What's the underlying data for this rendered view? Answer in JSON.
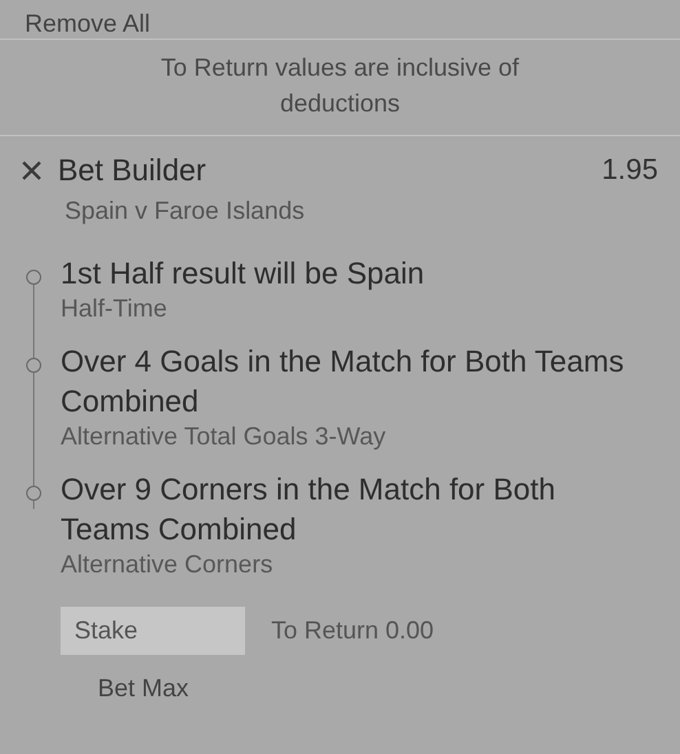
{
  "remove_all": "Remove All",
  "notice": "To Return values are inclusive of deductions",
  "bet": {
    "title": "Bet Builder",
    "odds": "1.95",
    "match": "Spain v Faroe Islands",
    "legs": [
      {
        "selection": "1st Half result will be Spain",
        "market": "Half-Time"
      },
      {
        "selection": "Over 4 Goals in the Match for Both Teams Combined",
        "market": "Alternative Total Goals 3-Way"
      },
      {
        "selection": "Over 9 Corners in the Match for Both Teams Combined",
        "market": "Alternative Corners"
      }
    ]
  },
  "stake": {
    "placeholder": "Stake"
  },
  "to_return": "To Return 0.00",
  "bet_max": "Bet Max"
}
